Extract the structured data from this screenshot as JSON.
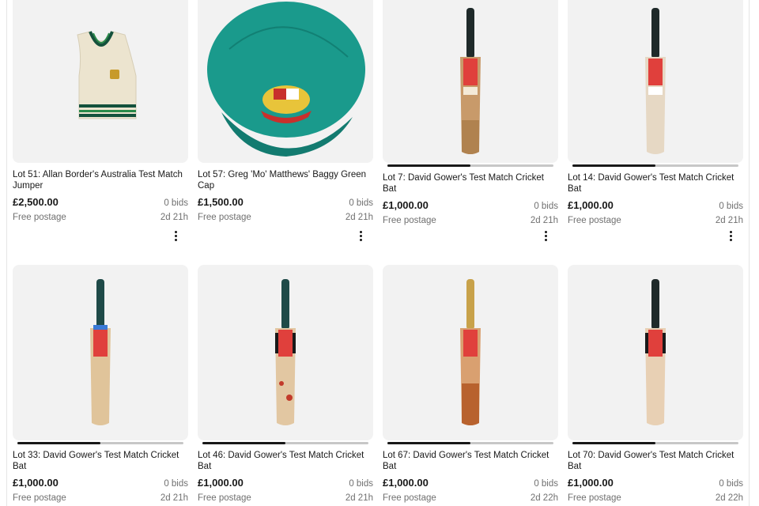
{
  "listings": [
    {
      "title": "Lot 51: Allan Border's Australia Test Match Jumper",
      "price": "£2,500.00",
      "bids": "0 bids",
      "postage": "Free postage",
      "time_left": "2d 21h",
      "image": "cricket-jumper"
    },
    {
      "title": "Lot 57: Greg 'Mo' Matthews' Baggy Green Cap",
      "price": "£1,500.00",
      "bids": "0 bids",
      "postage": "Free postage",
      "time_left": "2d 21h",
      "image": "baggy-green-cap"
    },
    {
      "title": "Lot 7: David Gower's Test Match Cricket Bat",
      "price": "£1,000.00",
      "bids": "0 bids",
      "postage": "Free postage",
      "time_left": "2d 21h",
      "image": "cricket-bat",
      "carousel_progress": 0.5
    },
    {
      "title": "Lot 14: David Gower's Test Match Cricket Bat",
      "price": "£1,000.00",
      "bids": "0 bids",
      "postage": "Free postage",
      "time_left": "2d 21h",
      "image": "cricket-bat",
      "carousel_progress": 0.5
    },
    {
      "title": "Lot 33: David Gower's Test Match Cricket Bat",
      "price": "£1,000.00",
      "bids": "0 bids",
      "postage": "Free postage",
      "time_left": "2d 21h",
      "image": "cricket-bat",
      "carousel_progress": 0.5
    },
    {
      "title": "Lot 46: David Gower's Test Match Cricket Bat",
      "price": "£1,000.00",
      "bids": "0 bids",
      "postage": "Free postage",
      "time_left": "2d 21h",
      "image": "cricket-bat",
      "carousel_progress": 0.5
    },
    {
      "title": "Lot 67: David Gower's Test Match Cricket Bat",
      "price": "£1,000.00",
      "bids": "0 bids",
      "postage": "Free postage",
      "time_left": "2d 22h",
      "image": "cricket-bat",
      "carousel_progress": 0.5
    },
    {
      "title": "Lot 70: David Gower's Test Match Cricket Bat",
      "price": "£1,000.00",
      "bids": "0 bids",
      "postage": "Free postage",
      "time_left": "2d 22h",
      "image": "cricket-bat",
      "carousel_progress": 0.5
    }
  ],
  "colors": {
    "price": "#191919",
    "secondary_text": "#707070",
    "thumb_bg": "#f2f2f2",
    "cap_green": "#1a9a8c",
    "bat_grip": "#1f4a48",
    "bat_willow": "#d2a878",
    "bat_label_red": "#e0403c"
  },
  "icons": {
    "more_menu": "more-vertical-icon"
  }
}
